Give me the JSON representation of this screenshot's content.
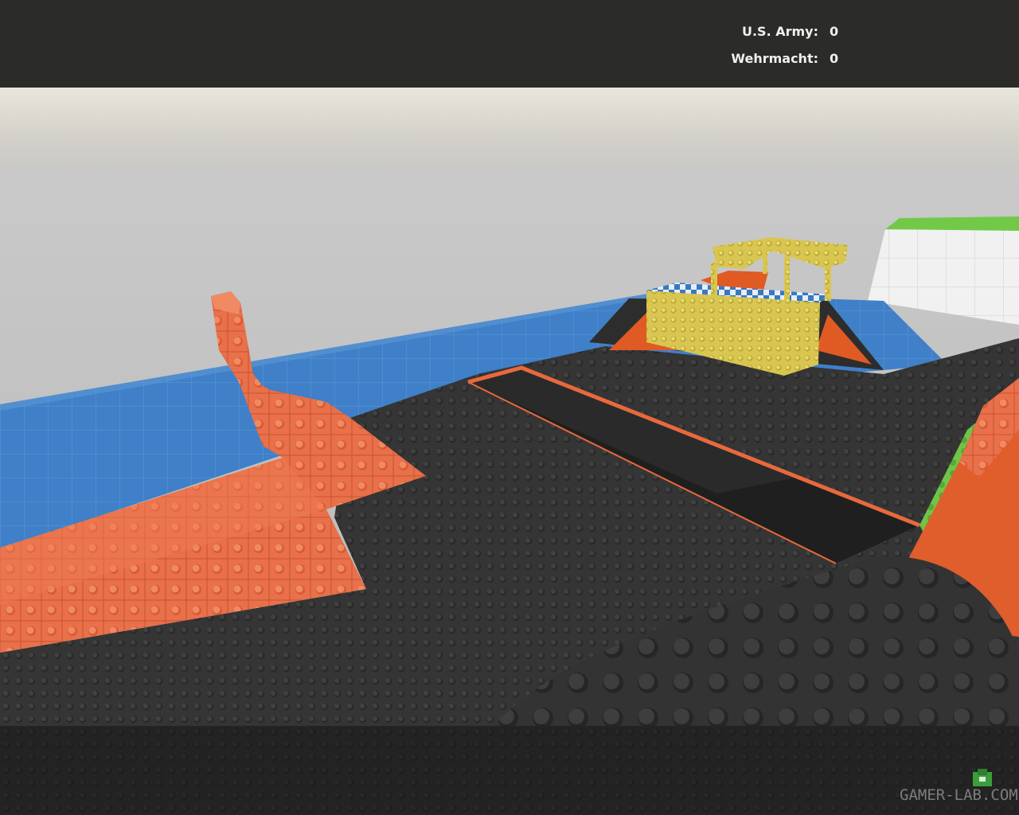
{
  "hud": {
    "scoreboard": [
      {
        "team": "U.S. Army:",
        "score": "0"
      },
      {
        "team": "Wehrmacht:",
        "score": "0"
      }
    ]
  },
  "watermark": {
    "text": "GAMER-LAB.COM"
  },
  "colors": {
    "hud_bar": "#2b2b2a",
    "hud_text": "#f0f0f0",
    "sky": "#c8c8c6",
    "water_blue": "#3d7ec6",
    "floor_dark": "#353535",
    "brick_orange": "#e8693c",
    "brick_yellow": "#d9c24a",
    "brick_green": "#6ec845",
    "wall_white": "#eeeeee"
  }
}
